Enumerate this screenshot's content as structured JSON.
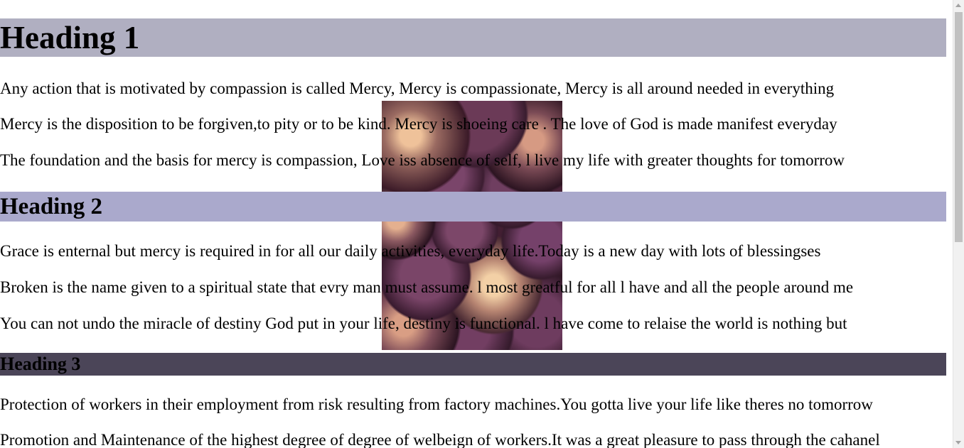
{
  "headings": {
    "h1": "Heading 1",
    "h2": "Heading 2",
    "h3": "Heading 3"
  },
  "section1": {
    "paragraphs": [
      "Any action that is motivated by compassion is called Mercy, Mercy is compassionate, Mercy is all around needed in everything",
      "Mercy is the disposition to be forgiven,to pity or to be kind. Mercy is shoeing care . The love of God is made manifest everyday",
      "The foundation and the basis for mercy is compassion, Love iss absence of self, l live my life with greater thoughts for tomorrow"
    ]
  },
  "section2": {
    "paragraphs": [
      "Grace is enternal but mercy is required in for all our daily activities, everyday life.Today is a new day with lots of blessingses",
      "Broken is the name given to a spiritual state that evry man must assume. l most greatful for all l have and all the people around me",
      "You can not undo the miracle of destiny God put in your life, destiny is functional. l have come to relaise the world is nothing but"
    ]
  },
  "section3": {
    "paragraphs": [
      "Protection of workers in their employment from risk resulting from factory machines.You gotta live your life like theres no tomorrow",
      "Promotion and Maintenance of the highest degree of degree of welbeign of workers.It was a great pleasure to pass through the cahanel"
    ]
  },
  "colors": {
    "heading1_bg": "#b0afc1",
    "heading2_bg": "#aaa9cc",
    "heading3_bg": "#4b4558"
  },
  "image": {
    "icon": "decorative-spheres-image"
  }
}
